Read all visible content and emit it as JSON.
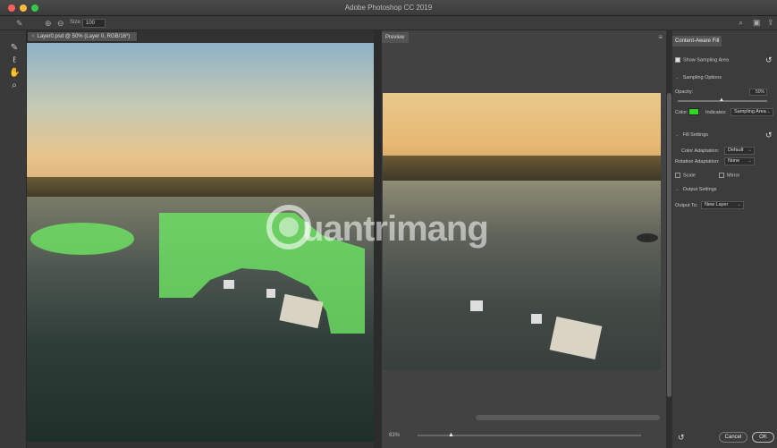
{
  "window": {
    "title": "Adobe Photoshop CC 2019"
  },
  "options_bar": {
    "size_label": "Size:",
    "size_value": "100"
  },
  "document": {
    "tab_title": "Layer0.psd @ 50% (Layer 0, RGB/16*)"
  },
  "preview": {
    "tab_label": "Preview",
    "zoom": "63%"
  },
  "panel": {
    "title": "Content-Aware Fill",
    "show_sampling_area": "Show Sampling Area",
    "sampling_options": {
      "section": "Sampling Options",
      "opacity_label": "Opacity:",
      "opacity_value": "50%",
      "color_label": "Color:",
      "indicates_label": "Indicates:",
      "indicates_value": "Sampling Area",
      "swatch_color": "#34d626"
    },
    "fill_settings": {
      "section": "Fill Settings",
      "color_adaptation_label": "Color Adaptation:",
      "color_adaptation_value": "Default",
      "rotation_adaptation_label": "Rotation Adaptation:",
      "rotation_adaptation_value": "None",
      "scale_label": "Scale",
      "mirror_label": "Mirror"
    },
    "output_settings": {
      "section": "Output Settings",
      "output_to_label": "Output To:",
      "output_to_value": "New Layer"
    },
    "cancel_label": "Cancel",
    "ok_label": "OK"
  },
  "watermark": {
    "text": "uantrimang"
  }
}
